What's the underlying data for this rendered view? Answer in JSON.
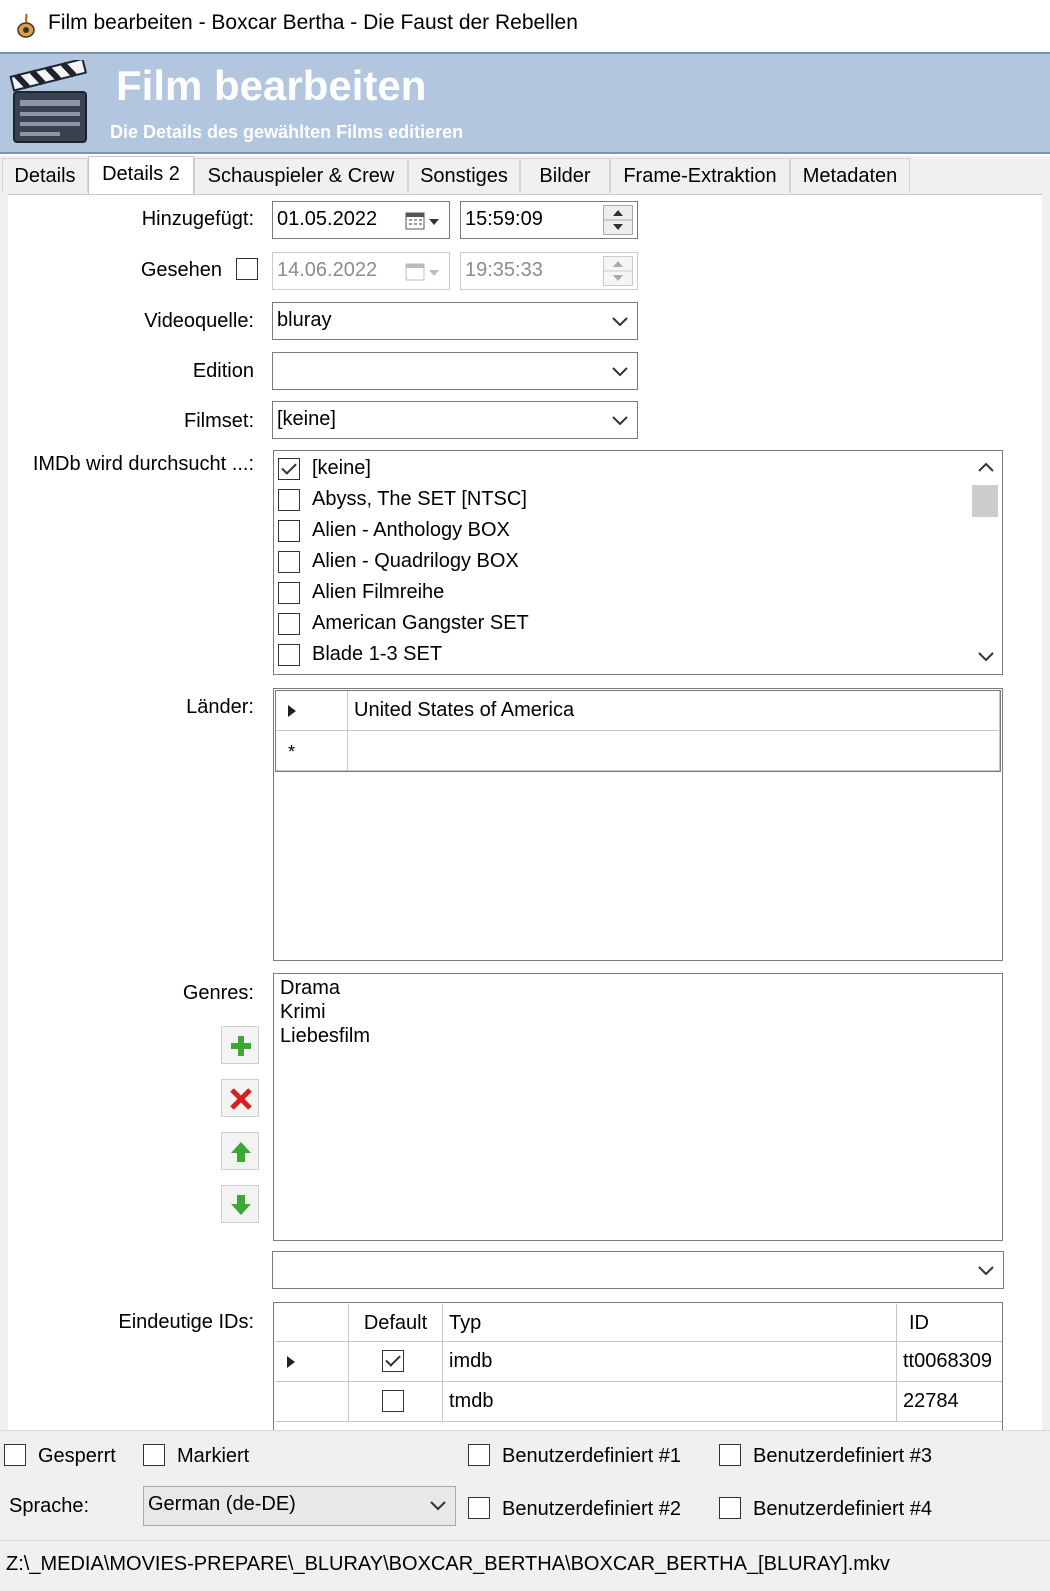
{
  "window": {
    "title": "Film bearbeiten - Boxcar Bertha - Die Faust der Rebellen"
  },
  "header": {
    "title": "Film bearbeiten",
    "subtitle": "Die Details des gewählten Films editieren"
  },
  "tabs": [
    {
      "label": "Details"
    },
    {
      "label": "Details 2",
      "active": true
    },
    {
      "label": "Schauspieler & Crew"
    },
    {
      "label": "Sonstiges"
    },
    {
      "label": "Bilder"
    },
    {
      "label": "Frame-Extraktion"
    },
    {
      "label": "Metadaten"
    }
  ],
  "form": {
    "added_label": "Hinzugefügt:",
    "added_date": "01.05.2022",
    "added_time": "15:59:09",
    "watched_label": "Gesehen",
    "watched_checked": false,
    "watched_date": "14.06.2022",
    "watched_time": "19:35:33",
    "videosource_label": "Videoquelle:",
    "videosource_value": "bluray",
    "edition_label": "Edition",
    "edition_value": "",
    "movieset_label": "Filmset:",
    "movieset_value": "[keine]",
    "imdb_label": "IMDb wird durchsucht ...:",
    "sets": [
      {
        "name": "[keine]",
        "checked": true
      },
      {
        "name": "Abyss, The SET [NTSC]",
        "checked": false
      },
      {
        "name": "Alien - Anthology BOX",
        "checked": false
      },
      {
        "name": "Alien - Quadrilogy BOX",
        "checked": false
      },
      {
        "name": "Alien Filmreihe",
        "checked": false
      },
      {
        "name": "American Gangster SET",
        "checked": false
      },
      {
        "name": "Blade 1-3 SET",
        "checked": false
      }
    ],
    "countries_label": "Länder:",
    "countries": [
      "United States of America"
    ],
    "genres_label": "Genres:",
    "genres": [
      "Drama",
      "Krimi",
      "Liebesfilm"
    ],
    "genre_combo_value": "",
    "ids_label": "Eindeutige IDs:",
    "ids_headers": {
      "default": "Default",
      "type": "Typ",
      "id": "ID"
    },
    "ids": [
      {
        "default": true,
        "type": "imdb",
        "id": "tt0068309"
      },
      {
        "default": false,
        "type": "tmdb",
        "id": "22784"
      }
    ]
  },
  "options": {
    "locked": "Gesperrt",
    "marked": "Markiert",
    "custom1": "Benutzerdefiniert #1",
    "custom2": "Benutzerdefiniert #2",
    "custom3": "Benutzerdefiniert #3",
    "custom4": "Benutzerdefiniert #4",
    "language_label": "Sprache:",
    "language_value": "German (de-DE)"
  },
  "status": {
    "path": "Z:\\_MEDIA\\MOVIES-PREPARE\\_BLURAY\\BOXCAR_BERTHA\\BOXCAR_BERTHA_[BLURAY].mkv"
  },
  "colors": {
    "banner": "#b2c6e0",
    "add": "#3aa832",
    "remove": "#d42020"
  }
}
